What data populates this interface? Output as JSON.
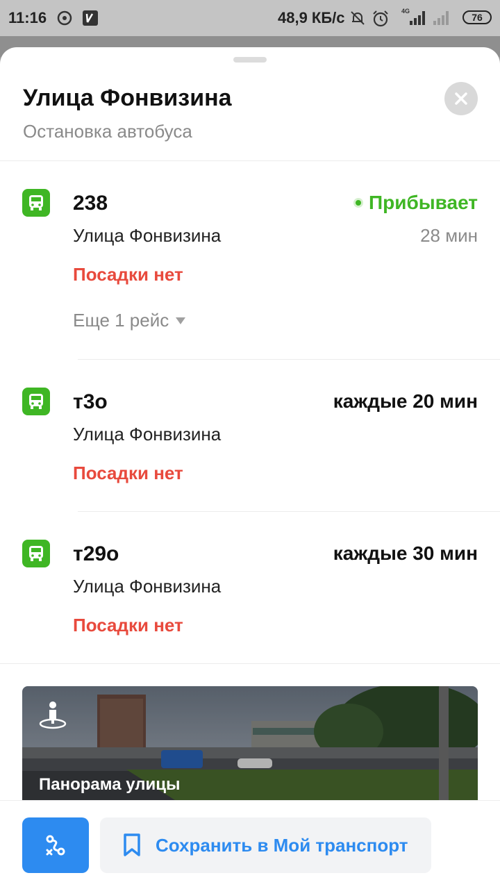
{
  "status_bar": {
    "time": "11:16",
    "speed": "48,9 КБ/с",
    "network": "4G",
    "battery": "76"
  },
  "stop": {
    "title": "Улица Фонвизина",
    "subtitle": "Остановка автобуса"
  },
  "routes": [
    {
      "number": "238",
      "destination": "Улица Фонвизина",
      "note": "Посадки нет",
      "status": "Прибывает",
      "eta": "28 мин",
      "more": "Еще 1 рейс"
    },
    {
      "number": "т3о",
      "destination": "Улица Фонвизина",
      "note": "Посадки нет",
      "frequency": "каждые 20 мин"
    },
    {
      "number": "т29о",
      "destination": "Улица Фонвизина",
      "note": "Посадки нет",
      "frequency": "каждые 30 мин"
    }
  ],
  "panorama": {
    "label": "Панорама улицы"
  },
  "bottom": {
    "save_label": "Сохранить в Мой транспорт"
  },
  "colors": {
    "accent_blue": "#2d8bf0",
    "bus_green": "#3fb624",
    "warning_red": "#e84a3d"
  }
}
